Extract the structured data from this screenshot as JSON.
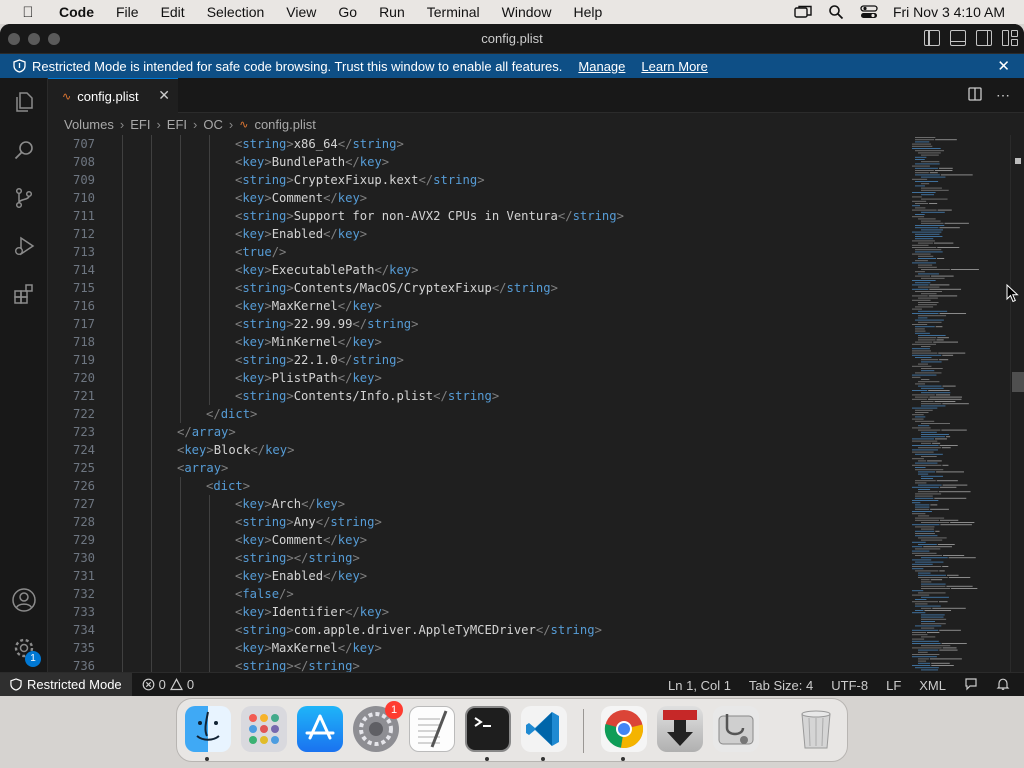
{
  "menubar": {
    "apple_icon": "apple-logo-icon",
    "items": [
      "Code",
      "File",
      "Edit",
      "Selection",
      "View",
      "Go",
      "Run",
      "Terminal",
      "Window",
      "Help"
    ],
    "tray_icons": [
      "screen-mirroring-icon",
      "spotlight-search-icon",
      "control-center-icon"
    ],
    "clock": "Fri Nov 3  4:10 AM"
  },
  "window": {
    "title": "config.plist"
  },
  "banner": {
    "message": "Restricted Mode is intended for safe code browsing. Trust this window to enable all features.",
    "manage_label": "Manage",
    "learn_more_label": "Learn More"
  },
  "tab": {
    "label": "config.plist"
  },
  "breadcrumb": {
    "parts": [
      "Volumes",
      "EFI",
      "EFI",
      "OC",
      "config.plist"
    ]
  },
  "editor": {
    "lines": [
      {
        "num": "707",
        "indent": 5,
        "tag": "string",
        "value": "x86_64"
      },
      {
        "num": "708",
        "indent": 5,
        "tag": "key",
        "value": "BundlePath"
      },
      {
        "num": "709",
        "indent": 5,
        "tag": "string",
        "value": "CryptexFixup.kext"
      },
      {
        "num": "710",
        "indent": 5,
        "tag": "key",
        "value": "Comment"
      },
      {
        "num": "711",
        "indent": 5,
        "tag": "string",
        "value": "Support for non-AVX2 CPUs in Ventura"
      },
      {
        "num": "712",
        "indent": 5,
        "tag": "key",
        "value": "Enabled"
      },
      {
        "num": "713",
        "indent": 5,
        "self": "true"
      },
      {
        "num": "714",
        "indent": 5,
        "tag": "key",
        "value": "ExecutablePath"
      },
      {
        "num": "715",
        "indent": 5,
        "tag": "string",
        "value": "Contents/MacOS/CryptexFixup"
      },
      {
        "num": "716",
        "indent": 5,
        "tag": "key",
        "value": "MaxKernel"
      },
      {
        "num": "717",
        "indent": 5,
        "tag": "string",
        "value": "22.99.99"
      },
      {
        "num": "718",
        "indent": 5,
        "tag": "key",
        "value": "MinKernel"
      },
      {
        "num": "719",
        "indent": 5,
        "tag": "string",
        "value": "22.1.0"
      },
      {
        "num": "720",
        "indent": 5,
        "tag": "key",
        "value": "PlistPath"
      },
      {
        "num": "721",
        "indent": 5,
        "tag": "string",
        "value": "Contents/Info.plist"
      },
      {
        "num": "722",
        "indent": 4,
        "close": "dict"
      },
      {
        "num": "723",
        "indent": 3,
        "close": "array"
      },
      {
        "num": "724",
        "indent": 3,
        "tag": "key",
        "value": "Block"
      },
      {
        "num": "725",
        "indent": 3,
        "open": "array"
      },
      {
        "num": "726",
        "indent": 4,
        "open": "dict"
      },
      {
        "num": "727",
        "indent": 5,
        "tag": "key",
        "value": "Arch"
      },
      {
        "num": "728",
        "indent": 5,
        "tag": "string",
        "value": "Any"
      },
      {
        "num": "729",
        "indent": 5,
        "tag": "key",
        "value": "Comment"
      },
      {
        "num": "730",
        "indent": 5,
        "tag": "string",
        "value": ""
      },
      {
        "num": "731",
        "indent": 5,
        "tag": "key",
        "value": "Enabled"
      },
      {
        "num": "732",
        "indent": 5,
        "self": "false"
      },
      {
        "num": "733",
        "indent": 5,
        "tag": "key",
        "value": "Identifier"
      },
      {
        "num": "734",
        "indent": 5,
        "tag": "string",
        "value": "com.apple.driver.AppleTyMCEDriver"
      },
      {
        "num": "735",
        "indent": 5,
        "tag": "key",
        "value": "MaxKernel"
      },
      {
        "num": "736",
        "indent": 5,
        "tag": "string",
        "value": ""
      }
    ]
  },
  "statusbar": {
    "restricted_label": "Restricted Mode",
    "errors": "0",
    "warnings": "0",
    "position": "Ln 1, Col 1",
    "tab_size": "Tab Size: 4",
    "encoding": "UTF-8",
    "eol": "LF",
    "language": "XML"
  },
  "activitybar": {
    "icons": [
      "explorer-icon",
      "search-icon",
      "source-control-icon",
      "run-and-debug-icon",
      "extensions-icon"
    ],
    "account_icon": "account-icon",
    "settings_icon": "settings-gear-icon",
    "settings_badge": "1"
  },
  "dock": {
    "apps": [
      {
        "name": "finder",
        "running": true
      },
      {
        "name": "launchpad",
        "running": false
      },
      {
        "name": "app-store",
        "running": false
      },
      {
        "name": "system-settings",
        "running": false,
        "badge": "1"
      },
      {
        "name": "textedit",
        "running": false
      },
      {
        "name": "terminal",
        "running": true
      },
      {
        "name": "visual-studio-code",
        "running": true
      },
      {
        "name": "google-chrome",
        "running": true
      },
      {
        "name": "downloader-app",
        "running": false
      },
      {
        "name": "disk-utility",
        "running": false
      },
      {
        "name": "trash",
        "running": false
      }
    ]
  },
  "colors": {
    "banner": "#0e4f86",
    "accent": "#0078d4",
    "tag_name": "#569cd6",
    "tag_bracket": "#808080",
    "text": "#d4d4d4",
    "editor_bg": "#1f1f1f"
  }
}
